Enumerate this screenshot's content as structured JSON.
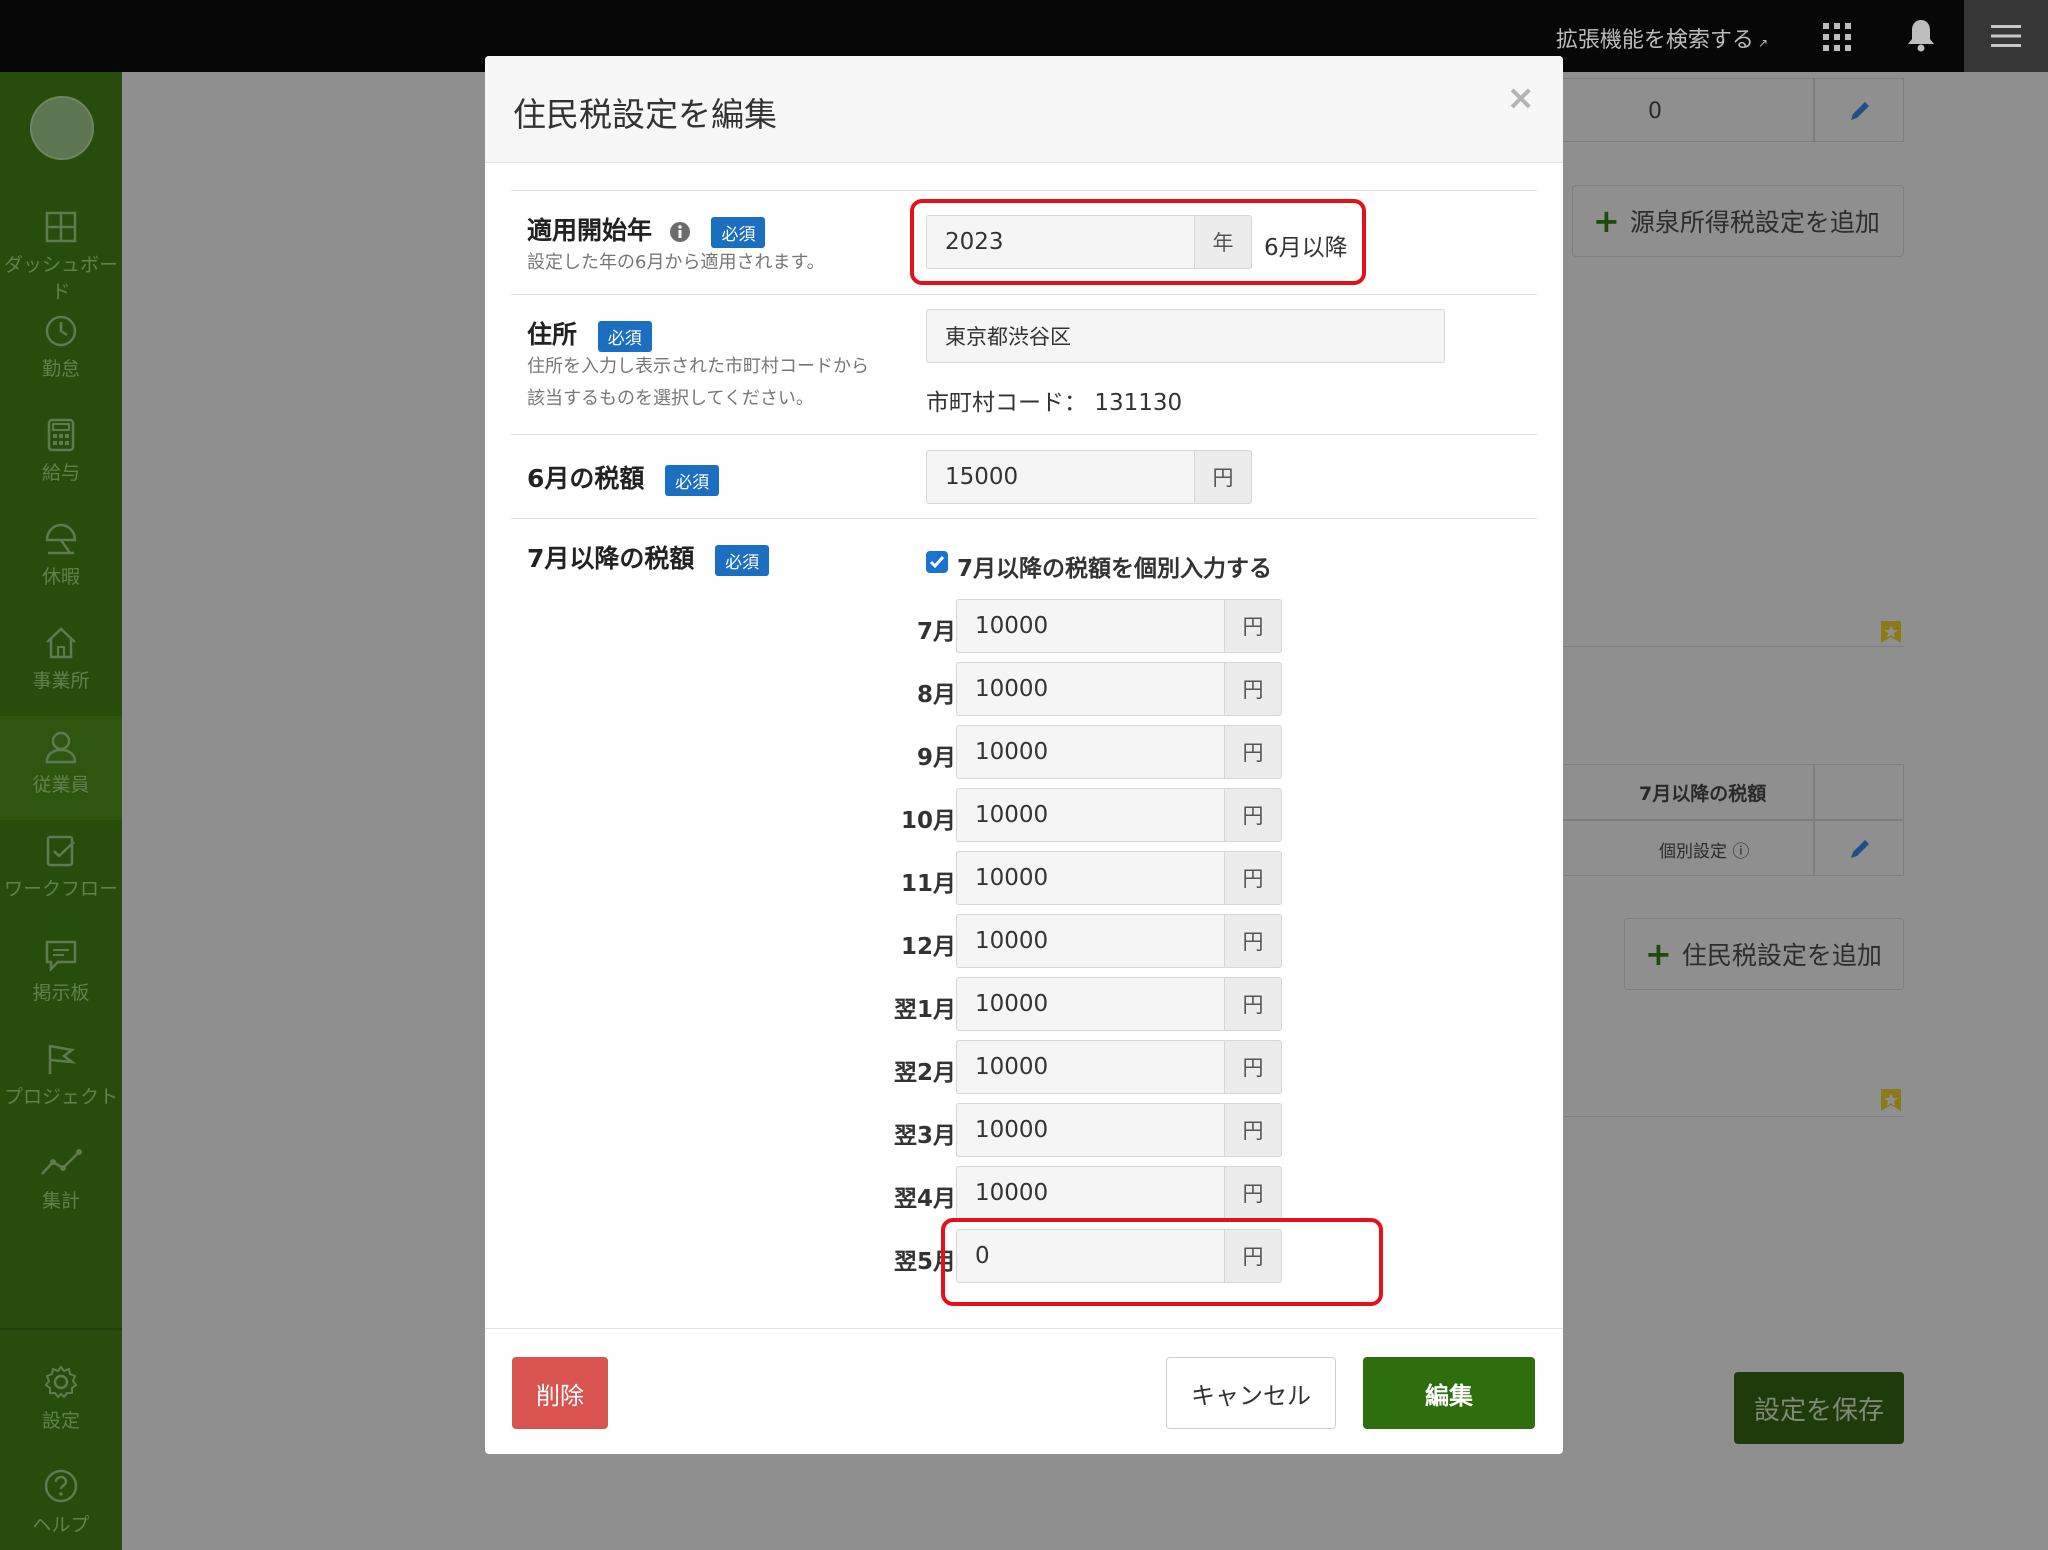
{
  "topbar": {
    "extension_search": "拡張機能を検索する",
    "apps_icon": "apps-grid-icon",
    "bell_icon": "bell-icon",
    "menu_icon": "hamburger-icon"
  },
  "sidebar": {
    "items": [
      {
        "label": "ダッシュボード",
        "icon": "dashboard-icon"
      },
      {
        "label": "勤怠",
        "icon": "clock-icon"
      },
      {
        "label": "給与",
        "icon": "calculator-icon"
      },
      {
        "label": "休暇",
        "icon": "umbrella-icon"
      },
      {
        "label": "事業所",
        "icon": "home-icon"
      },
      {
        "label": "従業員",
        "icon": "person-icon"
      },
      {
        "label": "ワークフロー",
        "icon": "checklist-icon"
      },
      {
        "label": "掲示板",
        "icon": "message-icon"
      },
      {
        "label": "プロジェクト",
        "icon": "flag-icon"
      },
      {
        "label": "集計",
        "icon": "chart-line-icon"
      }
    ],
    "bottom_items": [
      {
        "label": "設定",
        "icon": "gear-icon"
      },
      {
        "label": "ヘルプ",
        "icon": "help-icon"
      }
    ]
  },
  "background": {
    "top_value": "0",
    "add_withholding_label": "源泉所得税設定を追加",
    "col_header_after_july": "7月以降の税額",
    "individual_setting": "個別設定",
    "add_resident_tax_label": "住民税設定を追加",
    "save_settings_label": "設定を保存"
  },
  "modal": {
    "title": "住民税設定を編集",
    "close": "×",
    "required": "必須",
    "start_year": {
      "label": "適用開始年",
      "help": "設定した年の6月から適用されます。",
      "value": "2023",
      "unit": "年",
      "suffix": "6月以降"
    },
    "address": {
      "label": "住所",
      "help_line1": "住所を入力し表示された市町村コードから",
      "help_line2": "該当するものを選択してください。",
      "value": "東京都渋谷区",
      "muni_label": "市町村コード：",
      "muni_code": "131130"
    },
    "june_tax": {
      "label": "6月の税額",
      "value": "15000",
      "unit": "円"
    },
    "after_july": {
      "label": "7月以降の税額",
      "checkbox_label": "7月以降の税額を個別入力する",
      "checked": true,
      "unit": "円",
      "months": [
        {
          "label": "7月",
          "value": "10000"
        },
        {
          "label": "8月",
          "value": "10000"
        },
        {
          "label": "9月",
          "value": "10000"
        },
        {
          "label": "10月",
          "value": "10000"
        },
        {
          "label": "11月",
          "value": "10000"
        },
        {
          "label": "12月",
          "value": "10000"
        },
        {
          "label": "翌1月",
          "value": "10000"
        },
        {
          "label": "翌2月",
          "value": "10000"
        },
        {
          "label": "翌3月",
          "value": "10000"
        },
        {
          "label": "翌4月",
          "value": "10000"
        },
        {
          "label": "翌5月",
          "value": "0"
        }
      ]
    },
    "footer": {
      "delete_label": "削除",
      "cancel_label": "キャンセル",
      "edit_label": "編集"
    }
  },
  "colors": {
    "sidebar_bg": "#284c0c",
    "primary_green": "#2f6e0d",
    "required_badge": "#1b6fc0",
    "delete_red": "#d9534f",
    "highlight_red": "#e4111c"
  }
}
